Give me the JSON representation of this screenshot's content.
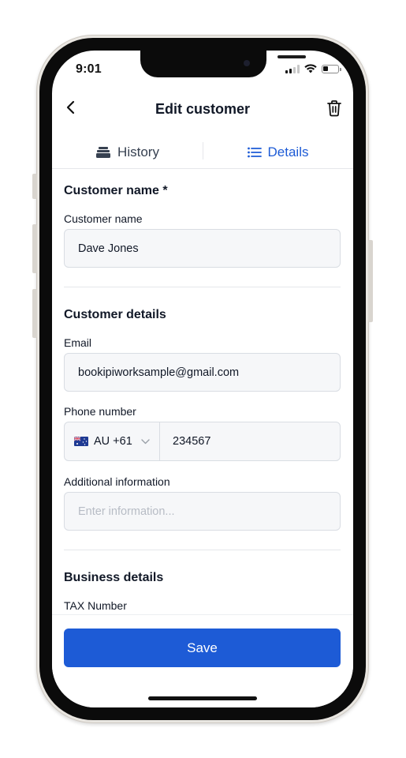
{
  "status_bar": {
    "time": "9:01"
  },
  "header": {
    "title": "Edit customer"
  },
  "tabs": [
    {
      "label": "History",
      "icon": "inbox-tray-icon",
      "active": false
    },
    {
      "label": "Details",
      "icon": "list-icon",
      "active": true
    }
  ],
  "sections": {
    "customer_name": {
      "title": "Customer name *",
      "field_label": "Customer name",
      "value": "Dave Jones"
    },
    "customer_details": {
      "title": "Customer details",
      "email_label": "Email",
      "email_value": "bookipiworksample@gmail.com",
      "phone_label": "Phone number",
      "country_code": "AU +61",
      "phone_value": "234567",
      "additional_label": "Additional information",
      "additional_placeholder": "Enter information..."
    },
    "business_details": {
      "title": "Business details",
      "tax_label": "TAX Number"
    }
  },
  "footer": {
    "save_label": "Save"
  },
  "colors": {
    "accent": "#1d5bd6",
    "input_bg": "#f6f7f9",
    "text": "#111827"
  }
}
